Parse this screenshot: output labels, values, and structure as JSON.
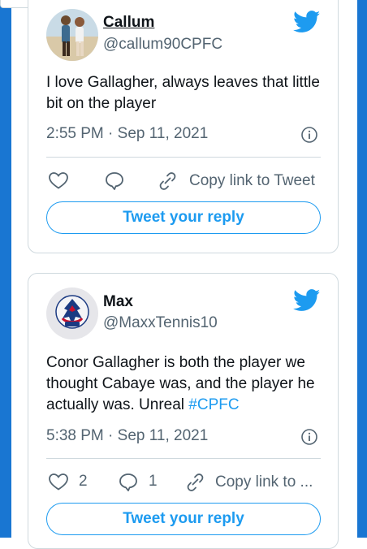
{
  "tweets": [
    {
      "author_name": "Callum",
      "author_handle": "@callum90CPFC",
      "text": "I love Gallagher, always leaves that little bit on the player",
      "timestamp": "2:55 PM · Sep 11, 2021",
      "copy_link_label": "Copy link to Tweet",
      "reply_button_label": "Tweet your reply"
    },
    {
      "author_name": "Max",
      "author_handle": "@MaxxTennis10",
      "text_before_hashtag": "Conor Gallagher is both the player we thought Cabaye was, and the player he actually was. Unreal ",
      "hashtag": "#CPFC",
      "timestamp": "5:38 PM · Sep 11, 2021",
      "like_count": "2",
      "reply_count": "1",
      "copy_link_label": "Copy link to ...",
      "reply_button_label": "Tweet your reply"
    }
  ],
  "colors": {
    "accent": "#1d9bf0",
    "border": "#cfd9de",
    "secondary_text": "#536471",
    "edge": "#1976d2"
  },
  "icons": [
    "twitter-bird-icon",
    "info-icon",
    "heart-icon",
    "reply-bubble-icon",
    "link-icon"
  ]
}
